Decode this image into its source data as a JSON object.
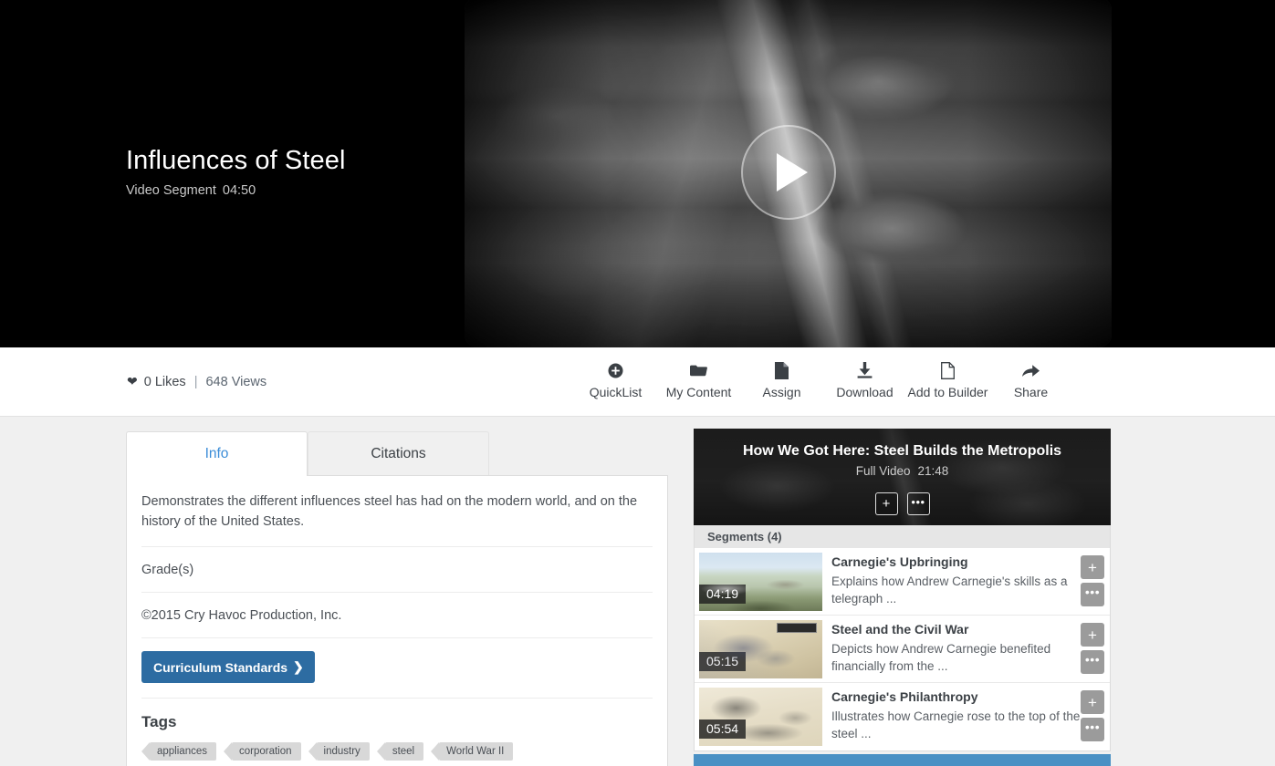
{
  "hero": {
    "title": "Influences of Steel",
    "type_label": "Video Segment",
    "duration": "04:50",
    "play_label": "play-button"
  },
  "stats": {
    "likes": "0 Likes",
    "separator": "|",
    "views": "648 Views",
    "heart_icon": "heart-icon"
  },
  "actions": [
    {
      "label": "QuickList",
      "icon": "plus-circle-icon"
    },
    {
      "label": "My Content",
      "icon": "folder-icon"
    },
    {
      "label": "Assign",
      "icon": "document-icon"
    },
    {
      "label": "Download",
      "icon": "download-icon"
    },
    {
      "label": "Add to Builder",
      "icon": "page-outline-icon"
    },
    {
      "label": "Share",
      "icon": "share-arrow-icon"
    }
  ],
  "tabs": [
    {
      "label": "Info",
      "active": true
    },
    {
      "label": "Citations",
      "active": false
    }
  ],
  "info": {
    "description": "Demonstrates the different influences steel has had on the modern world, and on the history of the United States.",
    "grades_label": "Grade(s)",
    "copyright": "©2015 Cry Havoc Production, Inc.",
    "standards_button": "Curriculum Standards",
    "standards_chevron": "❯",
    "tags_title": "Tags",
    "tags": [
      "appliances",
      "corporation",
      "industry",
      "steel",
      "World War II"
    ]
  },
  "related": {
    "title": "How We Got Here: Steel Builds the Metropolis",
    "type_label": "Full Video",
    "duration": "21:48",
    "add_button": "+",
    "more_button": "•••"
  },
  "segments_header": "Segments (4)",
  "segments": [
    {
      "title": "Carnegie's Upbringing",
      "description": "Explains how Andrew Carnegie's skills as a telegraph ...",
      "duration": "04:19",
      "add_button": "+",
      "more_button": "•••"
    },
    {
      "title": "Steel and the Civil War",
      "description": "Depicts how Andrew Carnegie benefited financially from the ...",
      "duration": "05:15",
      "add_button": "+",
      "more_button": "•••"
    },
    {
      "title": "Carnegie's Philanthropy",
      "description": "Illustrates how Carnegie rose to the top of the steel ...",
      "duration": "05:54",
      "add_button": "+",
      "more_button": "•••"
    }
  ],
  "colors": {
    "accent_blue": "#3b8dd8",
    "button_blue": "#2d6ca2",
    "bar_blue": "#4a90c4",
    "hero_bg": "#000000",
    "body_bg": "#f0f0f0"
  }
}
